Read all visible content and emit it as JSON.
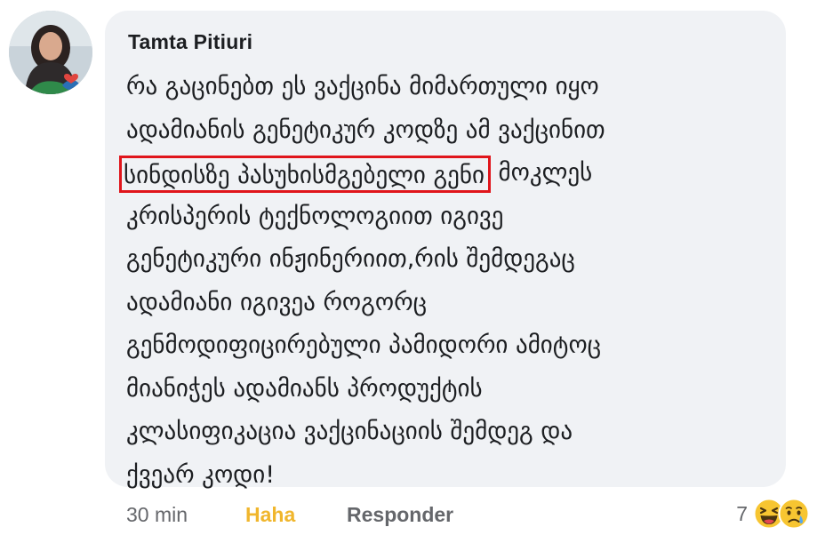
{
  "comment": {
    "author": "Tamta Pitiuri",
    "lines": [
      "რა გაცინებთ ეს ვაქცინა მიმართული იყო",
      "ადამიანის გენეტიკურ კოდზე ამ ვაქცინით",
      "მოკლეს",
      "კრისპერის ტექნოლოგიით იგივე",
      "გენეტიკური ინჟინერიით,რის შემდეგაც",
      "ადამიანი იგივეა როგორც",
      "გენმოდიფიცირებული პამიდორი ამიტოც",
      "მიანიჭეს ადამიანს პროდუქტის",
      "კლასიფიკაცია ვაქცინაციის შემდეგ და",
      "ქვეარ კოდი!"
    ],
    "highlighted": "სინდისზე პასუხისმგებელი გენი"
  },
  "meta": {
    "time": "30 min",
    "reaction_label": "Haha",
    "reply_label": "Responder"
  },
  "reactions": {
    "count": "7",
    "icons": [
      "haha-emoji",
      "sad-emoji"
    ]
  },
  "colors": {
    "bubble": "#f0f2f5",
    "haha_label": "#f0b62d",
    "highlight_border": "#e0151b",
    "muted_text": "#65676b"
  }
}
